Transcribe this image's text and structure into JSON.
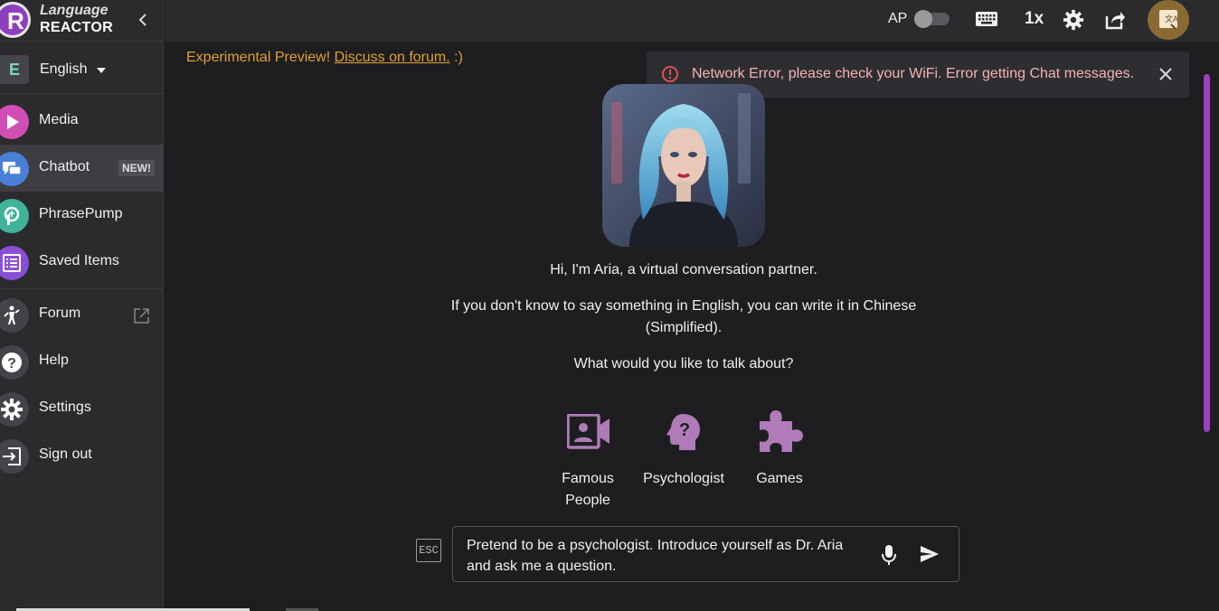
{
  "app": {
    "name_line1": "Language",
    "name_line2": "REACTOR"
  },
  "language": {
    "badge": "E",
    "label": "English"
  },
  "nav": {
    "media": "Media",
    "chatbot": "Chatbot",
    "chatbot_badge": "NEW!",
    "phrasepump": "PhrasePump",
    "saved": "Saved Items",
    "forum": "Forum",
    "help": "Help",
    "settings": "Settings",
    "signout": "Sign out"
  },
  "topbar": {
    "ap_label": "AP",
    "speed": "1x"
  },
  "preview": {
    "text": "Experimental Preview! ",
    "link": "Discuss on forum.",
    "suffix": " :)"
  },
  "toast": {
    "message": "Network Error, please check your WiFi. Error getting Chat messages."
  },
  "chat": {
    "intro": "Hi, I'm Aria, a virtual conversation partner.",
    "hint": "If you don't know to say something in English, you can write it in Chinese (Simplified).",
    "question": "What would you like to talk about?",
    "topics": [
      "Famous People",
      "Psychologist",
      "Games"
    ],
    "esc": "ESC",
    "input_value": "Pretend to be a psychologist. Introduce yourself as Dr. Aria and ask me a question."
  },
  "colors": {
    "accent": "#9b3ec0",
    "warning": "#e0a030",
    "topic_icon": "#b07bb8",
    "error": "#e05050"
  }
}
